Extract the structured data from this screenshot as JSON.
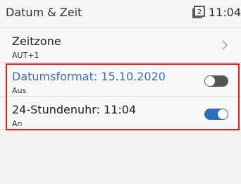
{
  "header": {
    "title": "Datum & Zeit",
    "time": "11:04",
    "status_icon": "notification-count-icon",
    "status_icon_count": "2"
  },
  "settings": {
    "zeitzone": {
      "label": "Zeitzone",
      "value": "AUT+1",
      "icon": "chevron-right-icon"
    },
    "datumsformat": {
      "label": "Datumsformat: 15.10.2020",
      "state_label": "Aus",
      "enabled": false
    },
    "stundenuhr": {
      "label": "24-Stundenuhr: 11:04",
      "state_label": "An",
      "enabled": true
    }
  },
  "colors": {
    "accent": "#2e6db8",
    "highlight_border": "#e02020",
    "toggle_off": "#555555"
  }
}
